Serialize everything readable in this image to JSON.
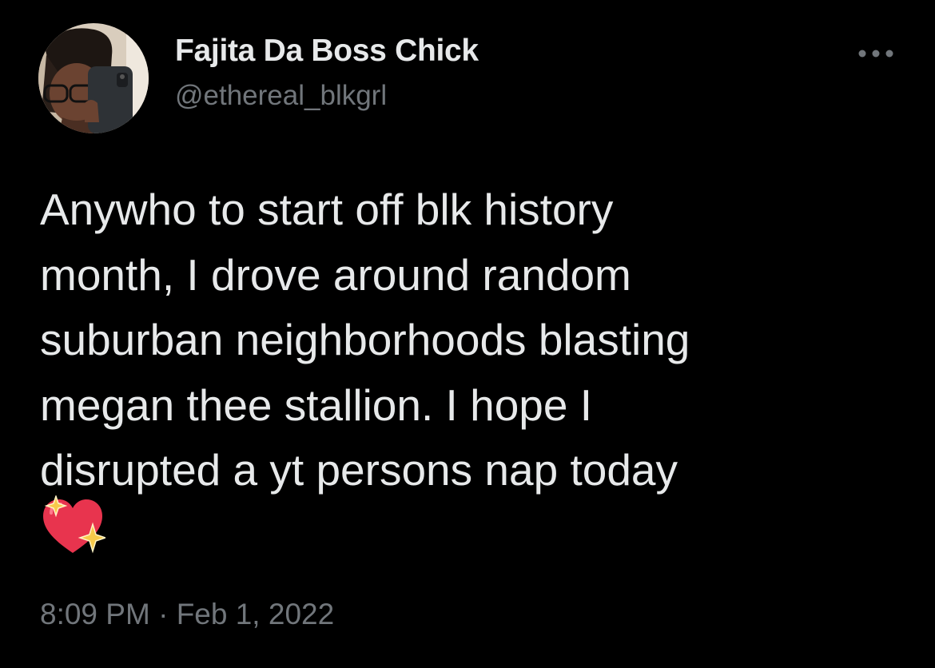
{
  "author": {
    "display_name": "Fajita Da Boss Chick",
    "handle": "@ethereal_blkgrl"
  },
  "tweet": {
    "lines": [
      "Anywho to start off blk history",
      "month, I drove around random",
      "suburban neighborhoods blasting",
      "megan thee stallion. I hope I",
      "disrupted a yt persons nap today"
    ],
    "emoji": "sparkling-heart"
  },
  "meta": {
    "time": "8:09 PM",
    "separator": " · ",
    "date": "Feb 1, 2022"
  },
  "icons": {
    "more": "more-horizontal-icon"
  },
  "colors": {
    "background": "#000000",
    "primary_text": "#e7e9ea",
    "secondary_text": "#71767b",
    "heart": "#e8344e",
    "sparkle": "#f7c94a"
  }
}
